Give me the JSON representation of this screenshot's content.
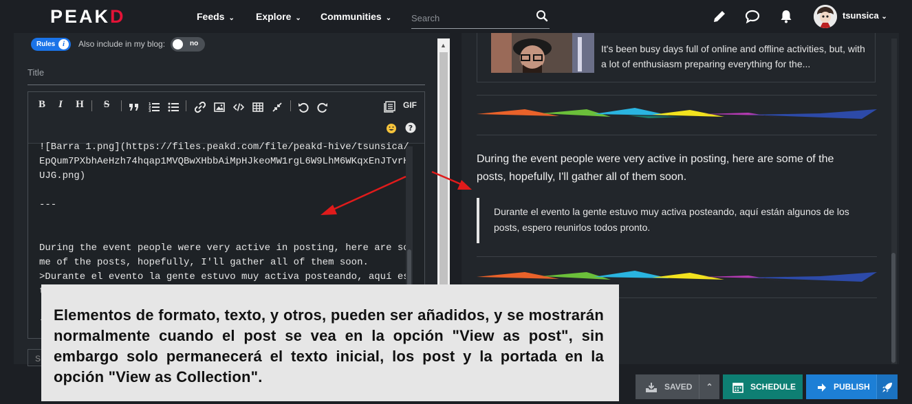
{
  "header": {
    "logo_main": "PEAK",
    "logo_accent": "D",
    "nav": [
      {
        "label": "Feeds"
      },
      {
        "label": "Explore"
      },
      {
        "label": "Communities"
      }
    ],
    "search_placeholder": "Search",
    "username": "tsunsica"
  },
  "editor": {
    "rules_label": "Rules",
    "blog_label": "Also include in my blog:",
    "toggle_label": "no",
    "toggle_on": false,
    "title_placeholder": "Title",
    "gif_label": "GIF",
    "body_text": "![Barra 1.png](https://files.peakd.com/file/peakd-hive/tsunsica/EpQum7PXbhAeHzh74hqap1MVQBwXHbbAiMpHJkeoMW1rgL6W9LhM6WKqxEnJTvrHUJG.png)\n\n---\n\n\nDuring the event people were very active in posting, here are some of the posts, hopefully, I'll gather all of them soon.\n>Durante el evento la gente estuvo muy activa posteando, aquí están algunos de los posts, espero reunirlos todos pronto.\n\n---",
    "stub_field_letter": "S"
  },
  "preview": {
    "card_text": "It's been busy days full of online and offline activities, but, with a lot of enthusiasm preparing everything for the...",
    "paragraph": "During the event people were very active in posting, here are some of the posts, hopefully, I'll gather all of them soon.",
    "quote": "Durante el evento la gente estuvo muy activa posteando, aquí están algunos de los posts, espero reunirlos todos pronto."
  },
  "footer": {
    "saved_label": "SAVED",
    "schedule_label": "SCHEDULE",
    "publish_label": "PUBLISH"
  },
  "caption": {
    "text": "Elementos de formato, texto, y otros, pueden ser añadidos, y se mostrarán normalmente cuando el post se vea en la opción \"View as post\", sin embargo solo permanecerá el texto inicial, los post y la portada en la opción \"View as Collection\"."
  },
  "colors": {
    "accent_red": "#e31337",
    "schedule_green": "#0e7f73",
    "publish_blue": "#1d7fd6",
    "annotation_arrow": "#e01b1b"
  }
}
